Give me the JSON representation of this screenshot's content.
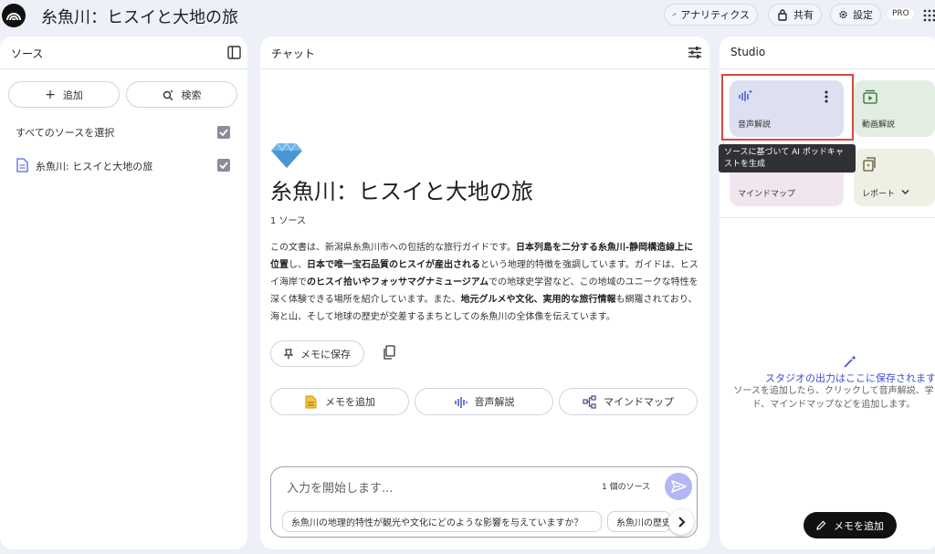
{
  "app": {
    "title": "糸魚川：ヒスイと大地の旅"
  },
  "topbar": {
    "analytics": "アナリティクス",
    "share": "共有",
    "settings": "設定",
    "pro": "PRO"
  },
  "sources": {
    "title": "ソース",
    "add": "追加",
    "search": "検索",
    "select_all": "すべてのソースを選択",
    "items": [
      {
        "label": "糸魚川: ヒスイと大地の旅"
      }
    ]
  },
  "chat": {
    "title": "チャット",
    "doc_title": "糸魚川：ヒスイと大地の旅",
    "source_count": "1 ソース",
    "summary": [
      {
        "text": "この文書は、新潟県糸魚川市への包括的な旅行ガイドです。",
        "bold": false
      },
      {
        "text": "日本列島を二分する糸魚川-静岡構造線上に位置",
        "bold": true
      },
      {
        "text": "し、",
        "bold": false
      },
      {
        "text": "日本で唯一宝石品質のヒスイが産出される",
        "bold": true
      },
      {
        "text": "という地理的特徴を強調しています。ガイドは、ヒスイ海岸で",
        "bold": false
      },
      {
        "text": "のヒスイ拾いやフォッサマグナミュージアム",
        "bold": true
      },
      {
        "text": "での地球史学習など、この地域のユニークな特性を深く体験できる場所を紹介しています。また、",
        "bold": false
      },
      {
        "text": "地元グルメや文化、実用的な旅行情報",
        "bold": true
      },
      {
        "text": "も網羅されており、海と山、そして地球の歴史が交差するまちとしての糸魚川の全体像を伝えています。",
        "bold": false
      }
    ],
    "save_memo": "メモに保存",
    "actions": {
      "add_memo": "メモを追加",
      "audio": "音声解説",
      "mindmap": "マインドマップ"
    },
    "input": {
      "placeholder": "入力を開始します...",
      "source_count": "1 個のソース",
      "suggestions": [
        "糸魚川の地理的特性が観光や文化にどのような影響を与えていますか？",
        "糸魚川の歴史"
      ]
    }
  },
  "studio": {
    "title": "Studio",
    "tiles": {
      "audio": "音声解説",
      "video": "動画解説",
      "mindmap": "マインドマップ",
      "report": "レポート"
    },
    "tooltip": "ソースに基づいて AI ポッドキャストを生成",
    "empty_title": "スタジオの出力はここに保存されます。",
    "empty_desc_1": "ソースを追加したら、クリックして音声解説、学",
    "empty_desc_2": "ド、マインドマップなどを追加します。",
    "fab": "メモを追加"
  },
  "colors": {
    "accent": "#3d4fd1",
    "audio_tile": "#dde0f0",
    "video_tile": "#e2eee2",
    "mindmap_tile": "#f1e6ef",
    "report_tile": "#f0efe4",
    "highlight": "#d5493a"
  }
}
